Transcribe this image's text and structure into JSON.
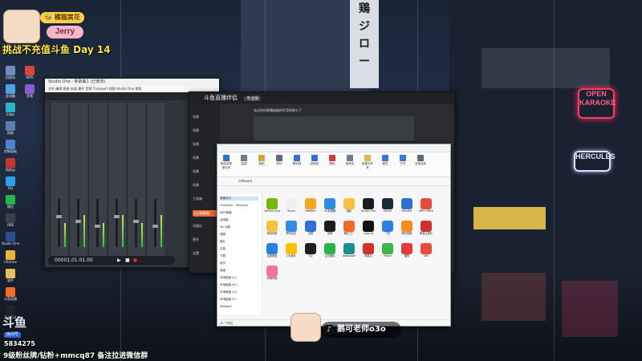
{
  "overlay": {
    "streamer_badge": "🐝 橘猫窝花",
    "streamer_name": "Jerry",
    "challenge_title": "挑战不充值斗鱼 Day 14",
    "platform_logo": "斗鱼",
    "room_label": "房间号",
    "room_id": "5834275",
    "bottom_banner": "9级粉丝牌/钻粉+mmcq87 备注拉进微信群",
    "douyin_handle": "鹅可老师o3o"
  },
  "desktop_icons": [
    {
      "label": "回收站",
      "color": "#6f8fb8"
    },
    {
      "label": "此电脑",
      "color": "#4aa3e6"
    },
    {
      "label": "Edge",
      "color": "#2bb3c7"
    },
    {
      "label": "网络",
      "color": "#5d7eb4"
    },
    {
      "label": "控制面板",
      "color": "#4d84d1"
    },
    {
      "label": "网易云",
      "color": "#c9342f"
    },
    {
      "label": "QQ",
      "color": "#2aa1e8"
    },
    {
      "label": "微信",
      "color": "#2ab34a"
    },
    {
      "label": "OBS",
      "color": "#3a3f48"
    },
    {
      "label": "Studio One",
      "color": "#2d4b8f"
    },
    {
      "label": "Chrome",
      "color": "#e9b437"
    },
    {
      "label": "软件",
      "color": "#e6c35a"
    },
    {
      "label": "斗鱼直播",
      "color": "#f06b2a"
    },
    {
      "label": "CapCut",
      "color": "#222222"
    },
    {
      "label": "WPS",
      "color": "#d8463a"
    },
    {
      "label": "音频",
      "color": "#8b5bd6"
    }
  ],
  "studio": {
    "title": "Studio One - 新歌曲1 (已修改)",
    "menu": "文件  编辑  歌曲  轨道  事件  音频  Transport  视图  Studio One  帮助",
    "timecode": "00001.01.01.00"
  },
  "manager": {
    "title": "斗鱼直播伴侣",
    "version": "专业版",
    "preview_caption": "永远的伴奏播放器的声音转换卡了",
    "sidebar": [
      "场景",
      "场景",
      "场景",
      "场景",
      "场景",
      "场景",
      "工具箱",
      "直播设置",
      "导播台",
      "更多",
      "设置"
    ],
    "sidebar_active_index": 7,
    "sidebar_active_label": "Lyn效果器"
  },
  "explorer": {
    "tabs": [
      "文件",
      "主页",
      "共享",
      "查看",
      "快捷方式工具",
      "应用程序工具"
    ],
    "highlight_tabs": [
      4,
      5
    ],
    "path": "software",
    "ribbon": [
      "固定到快速访问",
      "复制",
      "粘贴",
      "剪切",
      "移动到",
      "复制到",
      "删除",
      "重命名",
      "新建文件夹",
      "属性",
      "打开",
      "全部选择"
    ],
    "nav": [
      "快速访问",
      "OneDrive - Personal",
      "WPS网盘",
      "此电脑",
      "3D 对象",
      "视频",
      "图片",
      "文档",
      "下载",
      "音乐",
      "桌面",
      "本地磁盘 (C:)",
      "本地磁盘 (D:)",
      "本地磁盘 (E:)",
      "本地磁盘 (F:)",
      "Network"
    ],
    "nav_selected": 0,
    "status": "39 个项目",
    "apps": [
      {
        "label": "GeForce Experience",
        "color": "#76b900"
      },
      {
        "label": "iTunes",
        "color": "#f0f0f0"
      },
      {
        "label": "FabFilter",
        "color": "#f5a623"
      },
      {
        "label": "UU加速器",
        "color": "#2e8ce0"
      },
      {
        "label": "猎豹",
        "color": "#f7c23b"
      },
      {
        "label": "Studio One",
        "color": "#1c1c1c"
      },
      {
        "label": "Steam",
        "color": "#1b2838"
      },
      {
        "label": "Yamaha",
        "color": "#2d6fd2"
      },
      {
        "label": "WPS Office",
        "color": "#e84c3d"
      },
      {
        "label": "网易有道",
        "color": "#f7c23b"
      },
      {
        "label": "腾讯会议",
        "color": "#2f8ae5"
      },
      {
        "label": "迅雷",
        "color": "#2f6fd6"
      },
      {
        "label": "剪映",
        "color": "#1c1c1c"
      },
      {
        "label": "格式工厂",
        "color": "#f06a2a"
      },
      {
        "label": "CapCut",
        "color": "#111111"
      },
      {
        "label": "飞书",
        "color": "#2a7de1"
      },
      {
        "label": "腾讯视频",
        "color": "#ff8a1c"
      },
      {
        "label": "网易云音乐",
        "color": "#d3312c"
      },
      {
        "label": "百度网盘",
        "color": "#2a7fe4"
      },
      {
        "label": "QQ音乐",
        "color": "#f7c000"
      },
      {
        "label": "QQ",
        "color": "#1e1e1e"
      },
      {
        "label": "企业微信",
        "color": "#2ab34a"
      },
      {
        "label": "Wallpaper",
        "color": "#1a8f8f"
      },
      {
        "label": "网易云",
        "color": "#d3312c"
      },
      {
        "label": "Twitch",
        "color": "#3eb44a"
      },
      {
        "label": "酷狗",
        "color": "#e23b3b"
      },
      {
        "label": "OBS",
        "color": "#e74c3c"
      },
      {
        "label": "哔哩哔哩",
        "color": "#fb7299"
      }
    ]
  }
}
